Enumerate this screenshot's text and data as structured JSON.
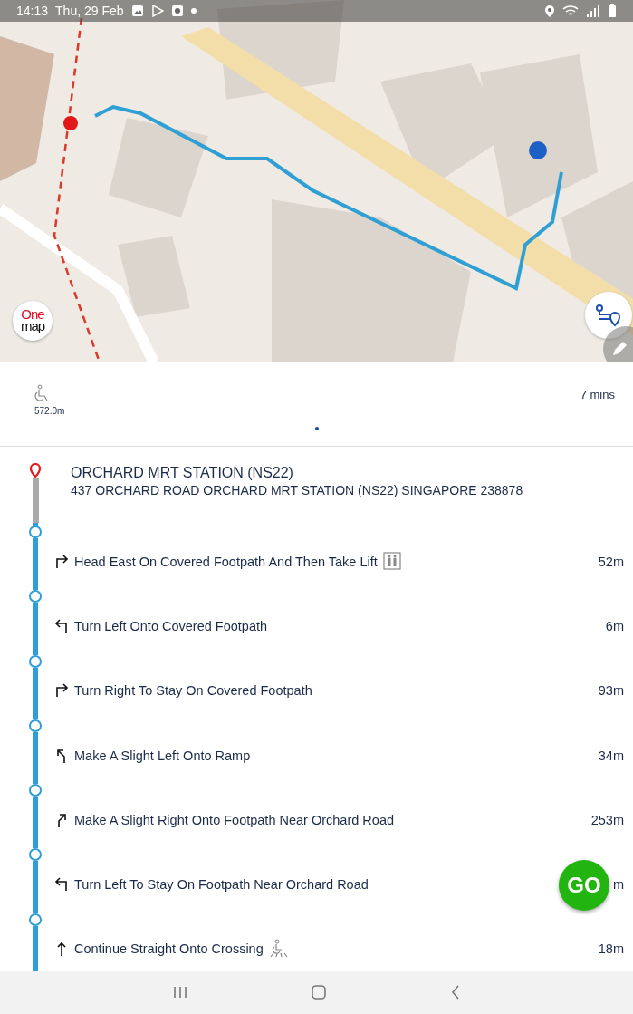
{
  "status_bar": {
    "time": "14:13",
    "date": "Thu, 29 Feb"
  },
  "map": {
    "kind": "picture",
    "logo": {
      "line_1": "One",
      "line_2": "map"
    }
  },
  "summary": {
    "distance": "572.0m",
    "duration": "7 mins",
    "pages": [
      {
        "selected": true
      }
    ]
  },
  "origin": {
    "name": "ORCHARD MRT STATION (NS22)",
    "address": "437 ORCHARD ROAD ORCHARD MRT STATION (NS22) SINGAPORE 238878"
  },
  "steps": [
    {
      "kind": "right",
      "text": "Head East On Covered Footpath And Then Take Lift",
      "icon": {
        "kind": "lift"
      },
      "distance": "52m"
    },
    {
      "kind": "left",
      "text": "Turn Left Onto Covered Footpath",
      "distance": "6m"
    },
    {
      "kind": "right",
      "text": "Turn Right To Stay On Covered Footpath",
      "distance": "93m"
    },
    {
      "kind": "slight-left",
      "text": "Make A Slight Left Onto Ramp",
      "distance": "34m"
    },
    {
      "kind": "slight-right",
      "text": "Make A Slight Right Onto Footpath Near Orchard Road",
      "distance": "253m"
    },
    {
      "kind": "left",
      "text": "Turn Left To Stay On Footpath Near Orchard Road",
      "distance": "m"
    },
    {
      "kind": "straight",
      "text": "Continue Straight Onto Crossing",
      "icon": {
        "kind": "crossing"
      },
      "distance": "18m"
    }
  ],
  "go_button": {
    "label": "GO"
  }
}
